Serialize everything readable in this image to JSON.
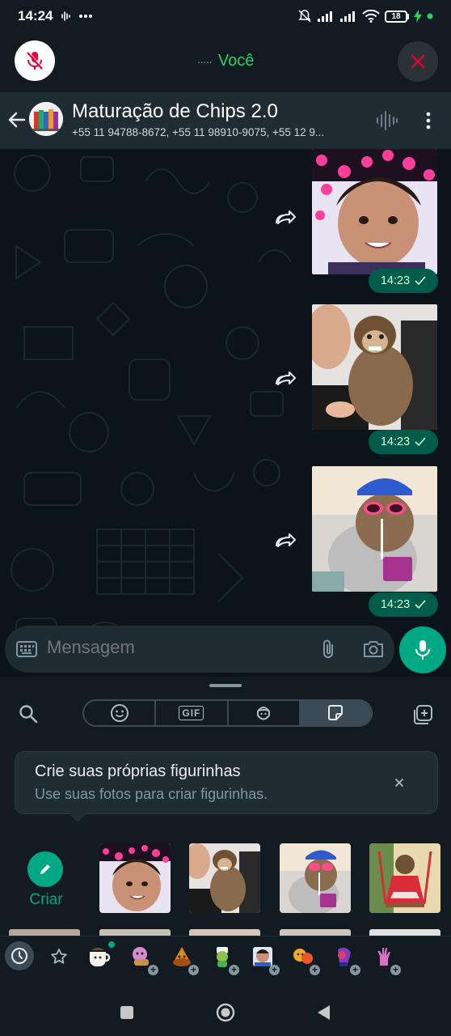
{
  "status_bar": {
    "time": "14:24",
    "battery": "18"
  },
  "call_bar": {
    "label": "Você",
    "dots": "·····"
  },
  "chat_header": {
    "title": "Maturação de Chips 2.0",
    "members": "+55 11 94788-8672, +55 11 98910-9075, +55 12 9..."
  },
  "messages": [
    {
      "time": "14:23",
      "sticker": "girl-heart-crown-sticker",
      "forwarded": true
    },
    {
      "time": "14:23",
      "sticker": "monkey-held-sticker",
      "forwarded": true
    },
    {
      "time": "14:23",
      "sticker": "monkey-sunglasses-juice-sticker",
      "forwarded": true
    }
  ],
  "composer": {
    "placeholder": "Mensagem"
  },
  "sticker_panel": {
    "tabs": [
      "emoji",
      "GIF",
      "avatar",
      "stickers"
    ],
    "gif_label": "GIF",
    "active_tab": "stickers",
    "tip_title": "Crie suas próprias figurinhas",
    "tip_subtitle": "Use suas fotos para criar figurinhas.",
    "create_label": "Criar"
  },
  "colors": {
    "accent": "#00a884",
    "call_green": "#25d366",
    "bubble_out": "#005c4b",
    "background": "#0b141a",
    "end_call_red": "#ea0038"
  }
}
